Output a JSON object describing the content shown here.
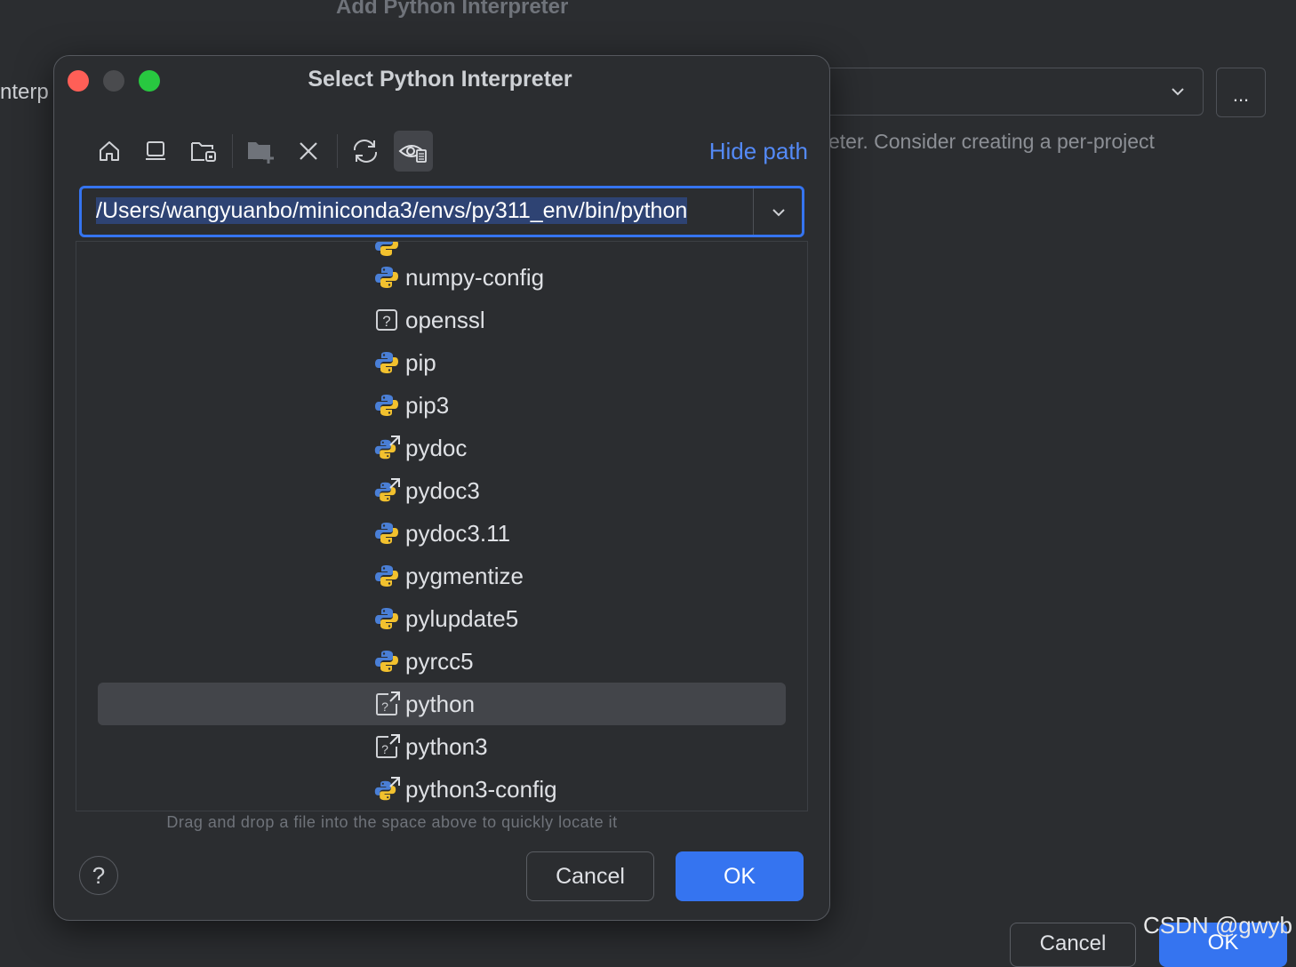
{
  "background": {
    "dialog_title": "Add Python Interpreter",
    "field_label": "nterp",
    "more_button": "...",
    "hint_text": "eter. Consider creating a per-project",
    "cancel_label": "Cancel",
    "ok_label": "OK"
  },
  "dialog": {
    "title": "Select Python Interpreter",
    "toolbar": {
      "items": [
        {
          "name": "home-icon"
        },
        {
          "name": "desktop-icon"
        },
        {
          "name": "project-folder-icon"
        },
        {
          "name": "new-folder-icon"
        },
        {
          "name": "delete-icon"
        },
        {
          "name": "refresh-icon"
        },
        {
          "name": "show-hidden-icon",
          "active": true
        }
      ],
      "hide_path": "Hide path"
    },
    "path": "/Users/wangyuanbo/miniconda3/envs/py311_env/bin/python",
    "files": [
      {
        "name": "numpy-config",
        "icon": "python-file-icon"
      },
      {
        "name": "openssl",
        "icon": "unknown-file-icon"
      },
      {
        "name": "pip",
        "icon": "python-file-icon"
      },
      {
        "name": "pip3",
        "icon": "python-file-icon"
      },
      {
        "name": "pydoc",
        "icon": "python-symlink-icon"
      },
      {
        "name": "pydoc3",
        "icon": "python-symlink-icon"
      },
      {
        "name": "pydoc3.11",
        "icon": "python-file-icon"
      },
      {
        "name": "pygmentize",
        "icon": "python-file-icon"
      },
      {
        "name": "pylupdate5",
        "icon": "python-file-icon"
      },
      {
        "name": "pyrcc5",
        "icon": "python-file-icon"
      },
      {
        "name": "python",
        "icon": "symlink-unknown-icon",
        "selected": true
      },
      {
        "name": "python3",
        "icon": "symlink-unknown-icon"
      },
      {
        "name": "python3-config",
        "icon": "python-symlink-icon"
      }
    ],
    "drag_hint": "Drag and drop a file into the space above to quickly locate it",
    "help_label": "?",
    "cancel_label": "Cancel",
    "ok_label": "OK"
  },
  "watermark": "CSDN @gwyb",
  "colors": {
    "accent": "#3574f0",
    "link": "#548af7",
    "python_blue": "#4a7fd6",
    "python_yellow": "#f2c12e"
  }
}
